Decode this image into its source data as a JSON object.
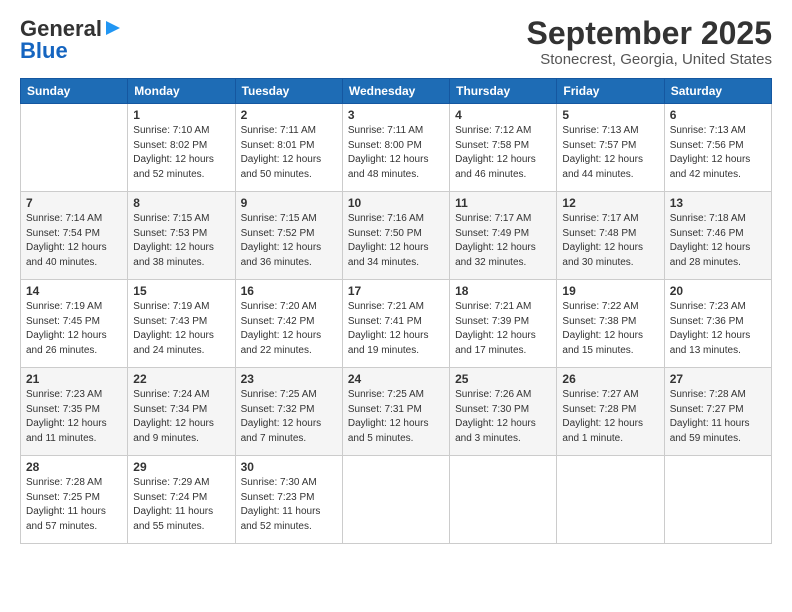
{
  "header": {
    "logo_line1": "General",
    "logo_line2": "Blue",
    "month": "September 2025",
    "location": "Stonecrest, Georgia, United States"
  },
  "days_of_week": [
    "Sunday",
    "Monday",
    "Tuesday",
    "Wednesday",
    "Thursday",
    "Friday",
    "Saturday"
  ],
  "weeks": [
    [
      {
        "day": "",
        "info": ""
      },
      {
        "day": "1",
        "info": "Sunrise: 7:10 AM\nSunset: 8:02 PM\nDaylight: 12 hours\nand 52 minutes."
      },
      {
        "day": "2",
        "info": "Sunrise: 7:11 AM\nSunset: 8:01 PM\nDaylight: 12 hours\nand 50 minutes."
      },
      {
        "day": "3",
        "info": "Sunrise: 7:11 AM\nSunset: 8:00 PM\nDaylight: 12 hours\nand 48 minutes."
      },
      {
        "day": "4",
        "info": "Sunrise: 7:12 AM\nSunset: 7:58 PM\nDaylight: 12 hours\nand 46 minutes."
      },
      {
        "day": "5",
        "info": "Sunrise: 7:13 AM\nSunset: 7:57 PM\nDaylight: 12 hours\nand 44 minutes."
      },
      {
        "day": "6",
        "info": "Sunrise: 7:13 AM\nSunset: 7:56 PM\nDaylight: 12 hours\nand 42 minutes."
      }
    ],
    [
      {
        "day": "7",
        "info": "Sunrise: 7:14 AM\nSunset: 7:54 PM\nDaylight: 12 hours\nand 40 minutes."
      },
      {
        "day": "8",
        "info": "Sunrise: 7:15 AM\nSunset: 7:53 PM\nDaylight: 12 hours\nand 38 minutes."
      },
      {
        "day": "9",
        "info": "Sunrise: 7:15 AM\nSunset: 7:52 PM\nDaylight: 12 hours\nand 36 minutes."
      },
      {
        "day": "10",
        "info": "Sunrise: 7:16 AM\nSunset: 7:50 PM\nDaylight: 12 hours\nand 34 minutes."
      },
      {
        "day": "11",
        "info": "Sunrise: 7:17 AM\nSunset: 7:49 PM\nDaylight: 12 hours\nand 32 minutes."
      },
      {
        "day": "12",
        "info": "Sunrise: 7:17 AM\nSunset: 7:48 PM\nDaylight: 12 hours\nand 30 minutes."
      },
      {
        "day": "13",
        "info": "Sunrise: 7:18 AM\nSunset: 7:46 PM\nDaylight: 12 hours\nand 28 minutes."
      }
    ],
    [
      {
        "day": "14",
        "info": "Sunrise: 7:19 AM\nSunset: 7:45 PM\nDaylight: 12 hours\nand 26 minutes."
      },
      {
        "day": "15",
        "info": "Sunrise: 7:19 AM\nSunset: 7:43 PM\nDaylight: 12 hours\nand 24 minutes."
      },
      {
        "day": "16",
        "info": "Sunrise: 7:20 AM\nSunset: 7:42 PM\nDaylight: 12 hours\nand 22 minutes."
      },
      {
        "day": "17",
        "info": "Sunrise: 7:21 AM\nSunset: 7:41 PM\nDaylight: 12 hours\nand 19 minutes."
      },
      {
        "day": "18",
        "info": "Sunrise: 7:21 AM\nSunset: 7:39 PM\nDaylight: 12 hours\nand 17 minutes."
      },
      {
        "day": "19",
        "info": "Sunrise: 7:22 AM\nSunset: 7:38 PM\nDaylight: 12 hours\nand 15 minutes."
      },
      {
        "day": "20",
        "info": "Sunrise: 7:23 AM\nSunset: 7:36 PM\nDaylight: 12 hours\nand 13 minutes."
      }
    ],
    [
      {
        "day": "21",
        "info": "Sunrise: 7:23 AM\nSunset: 7:35 PM\nDaylight: 12 hours\nand 11 minutes."
      },
      {
        "day": "22",
        "info": "Sunrise: 7:24 AM\nSunset: 7:34 PM\nDaylight: 12 hours\nand 9 minutes."
      },
      {
        "day": "23",
        "info": "Sunrise: 7:25 AM\nSunset: 7:32 PM\nDaylight: 12 hours\nand 7 minutes."
      },
      {
        "day": "24",
        "info": "Sunrise: 7:25 AM\nSunset: 7:31 PM\nDaylight: 12 hours\nand 5 minutes."
      },
      {
        "day": "25",
        "info": "Sunrise: 7:26 AM\nSunset: 7:30 PM\nDaylight: 12 hours\nand 3 minutes."
      },
      {
        "day": "26",
        "info": "Sunrise: 7:27 AM\nSunset: 7:28 PM\nDaylight: 12 hours\nand 1 minute."
      },
      {
        "day": "27",
        "info": "Sunrise: 7:28 AM\nSunset: 7:27 PM\nDaylight: 11 hours\nand 59 minutes."
      }
    ],
    [
      {
        "day": "28",
        "info": "Sunrise: 7:28 AM\nSunset: 7:25 PM\nDaylight: 11 hours\nand 57 minutes."
      },
      {
        "day": "29",
        "info": "Sunrise: 7:29 AM\nSunset: 7:24 PM\nDaylight: 11 hours\nand 55 minutes."
      },
      {
        "day": "30",
        "info": "Sunrise: 7:30 AM\nSunset: 7:23 PM\nDaylight: 11 hours\nand 52 minutes."
      },
      {
        "day": "",
        "info": ""
      },
      {
        "day": "",
        "info": ""
      },
      {
        "day": "",
        "info": ""
      },
      {
        "day": "",
        "info": ""
      }
    ]
  ]
}
